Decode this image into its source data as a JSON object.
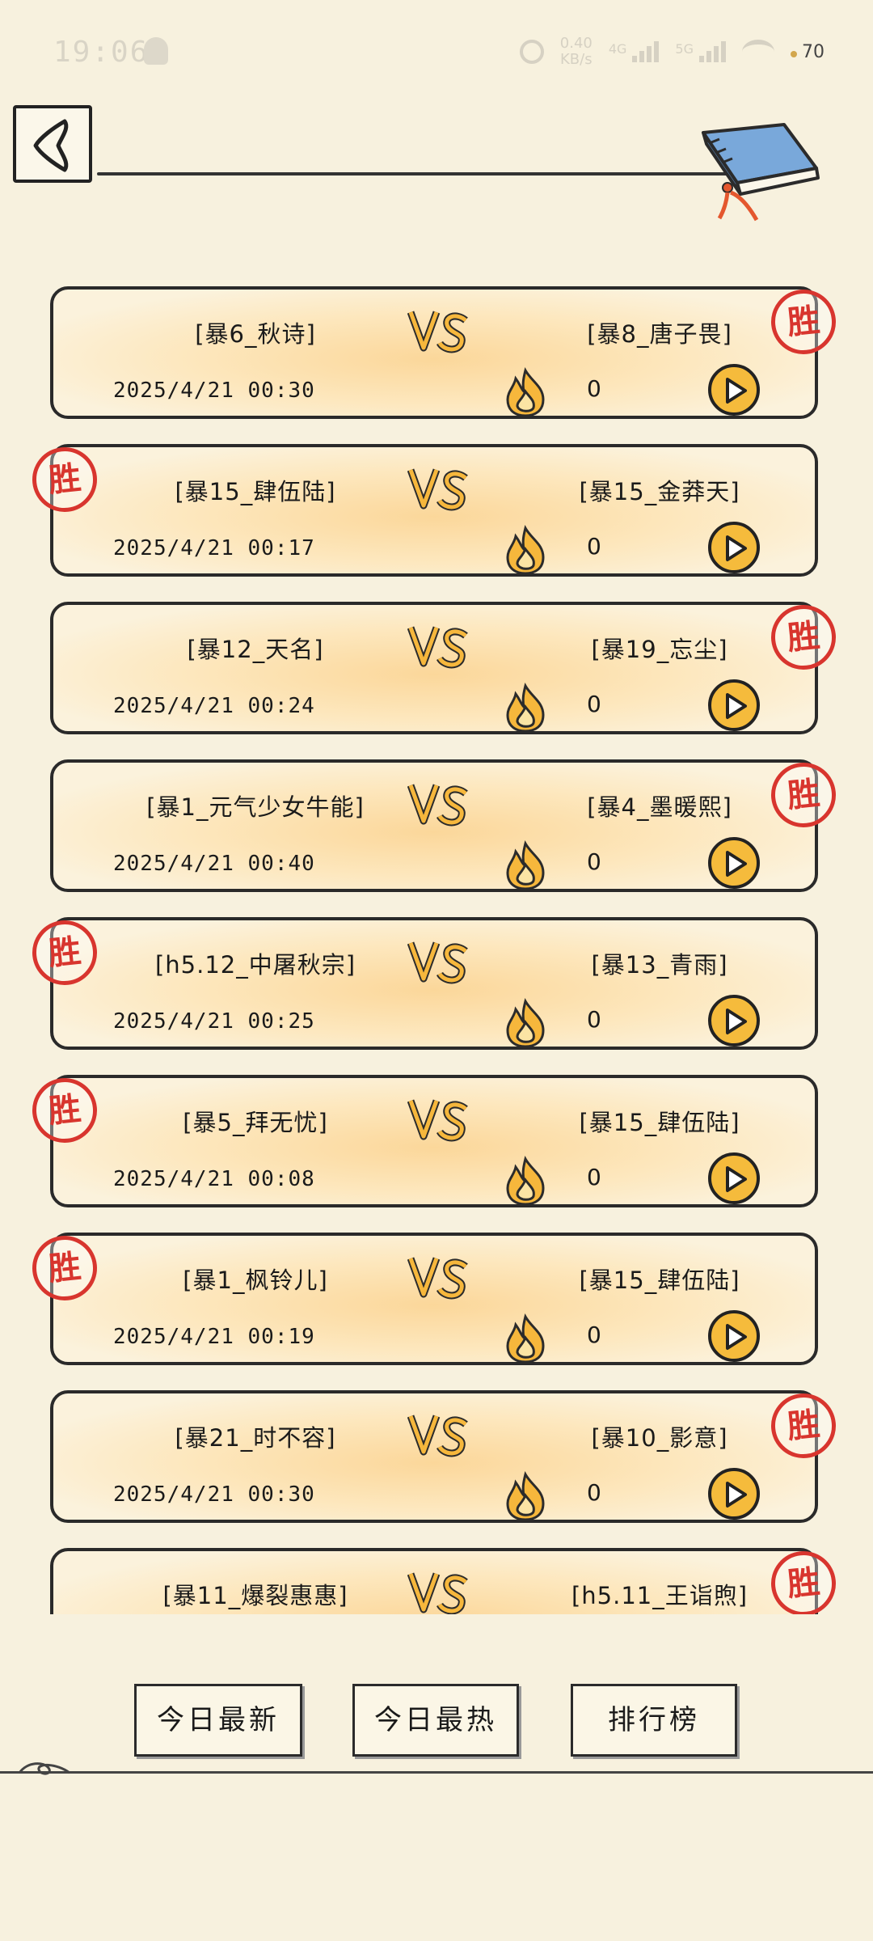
{
  "status_bar": {
    "time": "19:06",
    "speed_value": "0.40",
    "speed_unit": "KB/s",
    "net1": "4G",
    "net2": "5G",
    "battery": "70"
  },
  "matches": [
    {
      "player1": "[暴6_秋诗]",
      "player2": "[暴8_唐子畏]",
      "date": "2025/4/21  00:30",
      "count": "0",
      "winner": "right",
      "stamp": "胜"
    },
    {
      "player1": "[暴15_肆伍陆]",
      "player2": "[暴15_金莽天]",
      "date": "2025/4/21  00:17",
      "count": "0",
      "winner": "left",
      "stamp": "胜"
    },
    {
      "player1": "[暴12_天名]",
      "player2": "[暴19_忘尘]",
      "date": "2025/4/21  00:24",
      "count": "0",
      "winner": "right",
      "stamp": "胜"
    },
    {
      "player1": "[暴1_元气少女牛能]",
      "player2": "[暴4_墨暖熙]",
      "date": "2025/4/21  00:40",
      "count": "0",
      "winner": "right",
      "stamp": "胜"
    },
    {
      "player1": "[h5.12_中屠秋宗]",
      "player2": "[暴13_青雨]",
      "date": "2025/4/21  00:25",
      "count": "0",
      "winner": "left",
      "stamp": "胜"
    },
    {
      "player1": "[暴5_拜无忧]",
      "player2": "[暴15_肆伍陆]",
      "date": "2025/4/21  00:08",
      "count": "0",
      "winner": "left",
      "stamp": "胜"
    },
    {
      "player1": "[暴1_枫铃儿]",
      "player2": "[暴15_肆伍陆]",
      "date": "2025/4/21  00:19",
      "count": "0",
      "winner": "left",
      "stamp": "胜"
    },
    {
      "player1": "[暴21_时不容]",
      "player2": "[暴10_影意]",
      "date": "2025/4/21  00:30",
      "count": "0",
      "winner": "right",
      "stamp": "胜"
    },
    {
      "player1": "[暴11_爆裂惠惠]",
      "player2": "[h5.11_王诣煦]",
      "date": "",
      "count": "",
      "winner": "right",
      "stamp": "胜"
    }
  ],
  "tabs": {
    "latest": "今日最新",
    "hot": "今日最热",
    "rank": "排行榜"
  }
}
